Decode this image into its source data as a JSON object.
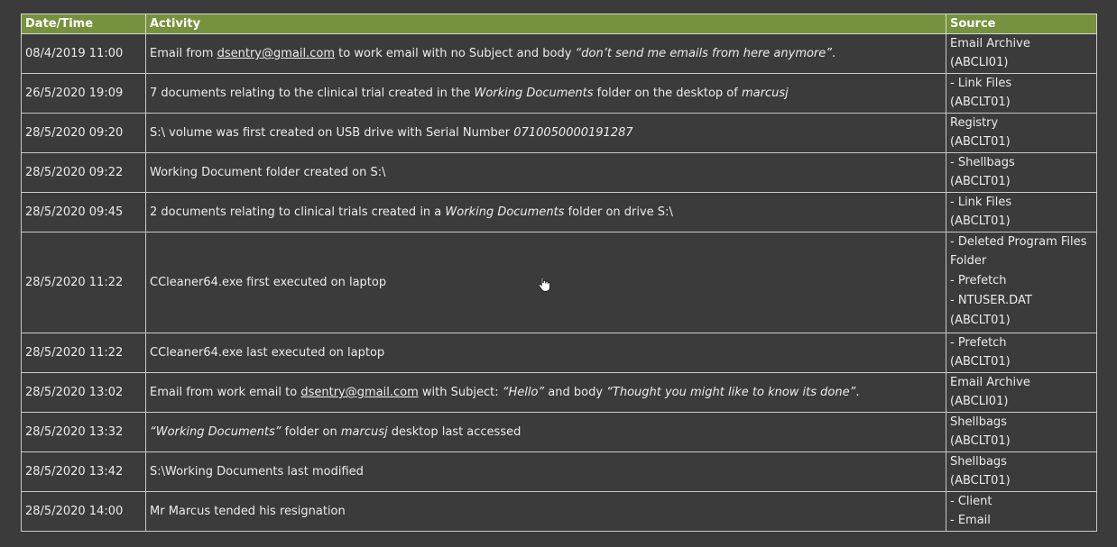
{
  "headers": {
    "datetime": "Date/Time",
    "activity": "Activity",
    "source": "Source"
  },
  "rows": [
    {
      "datetime": "08/4/2019 11:00",
      "activity": [
        {
          "t": "Email from "
        },
        {
          "t": "dsentry@gmail.com",
          "s": "u"
        },
        {
          "t": " to work email with no Subject and body "
        },
        {
          "t": "“don’t send me emails from here anymore”",
          "s": "i"
        },
        {
          "t": "."
        }
      ],
      "source": [
        "Email Archive",
        "(ABCLI01)"
      ]
    },
    {
      "datetime": "26/5/2020 19:09",
      "activity": [
        {
          "t": "7 documents relating to the clinical trial created in the "
        },
        {
          "t": "Working Documents",
          "s": "i"
        },
        {
          "t": " folder on the desktop of "
        },
        {
          "t": "marcusj",
          "s": "i"
        }
      ],
      "source": [
        "- Link Files",
        "(ABCLT01)"
      ]
    },
    {
      "datetime": "28/5/2020 09:20",
      "activity": [
        {
          "t": "S:\\ volume was first created on USB drive with Serial Number "
        },
        {
          "t": "0710050000191287",
          "s": "i"
        }
      ],
      "source": [
        "Registry",
        "(ABCLT01)"
      ]
    },
    {
      "datetime": "28/5/2020 09:22",
      "activity": [
        {
          "t": "Working Document folder created on S:\\"
        }
      ],
      "source": [
        "- Shellbags",
        "(ABCLT01)"
      ]
    },
    {
      "datetime": "28/5/2020 09:45",
      "activity": [
        {
          "t": "2 documents relating to clinical trials created in a "
        },
        {
          "t": "Working Documents",
          "s": "i"
        },
        {
          "t": " folder on drive S:\\"
        }
      ],
      "source": [
        "- Link Files",
        "(ABCLT01)"
      ]
    },
    {
      "datetime": "28/5/2020 11:22",
      "activity": [
        {
          "t": "CCleaner64.exe first executed on laptop"
        }
      ],
      "source": [
        "- Deleted Program Files",
        "Folder",
        "- Prefetch",
        "- NTUSER.DAT",
        "(ABCLT01)"
      ]
    },
    {
      "datetime": "28/5/2020 11:22",
      "activity": [
        {
          "t": "CCleaner64.exe last executed on laptop"
        }
      ],
      "source": [
        "- Prefetch",
        "(ABCLT01)"
      ]
    },
    {
      "datetime": "28/5/2020 13:02",
      "activity": [
        {
          "t": "Email from work email to "
        },
        {
          "t": "dsentry@gmail.com",
          "s": "u"
        },
        {
          "t": " with Subject: "
        },
        {
          "t": "“Hello”",
          "s": "i"
        },
        {
          "t": " and body "
        },
        {
          "t": "“Thought you might like to know its done”",
          "s": "i"
        },
        {
          "t": "."
        }
      ],
      "source": [
        "Email Archive",
        "(ABCLI01)"
      ]
    },
    {
      "datetime": "28/5/2020 13:32",
      "activity": [
        {
          "t": "“Working Documents”",
          "s": "i"
        },
        {
          "t": " folder on "
        },
        {
          "t": "marcusj",
          "s": "i"
        },
        {
          "t": " desktop last accessed"
        }
      ],
      "source": [
        "Shellbags",
        "(ABCLT01)"
      ]
    },
    {
      "datetime": "28/5/2020 13:42",
      "activity": [
        {
          "t": "S:\\Working Documents last modified"
        }
      ],
      "source": [
        "Shellbags",
        "(ABCLT01)"
      ]
    },
    {
      "datetime": "28/5/2020 14:00",
      "activity": [
        {
          "t": "Mr Marcus tended his resignation"
        }
      ],
      "source": [
        "- Client",
        "- Email"
      ]
    }
  ],
  "colors": {
    "background": "#3b3b3b",
    "header": "#76923c",
    "grid": "#c8c8c8",
    "text": "#ececec"
  },
  "cursor": {
    "icon": "hand-pointer-icon"
  }
}
